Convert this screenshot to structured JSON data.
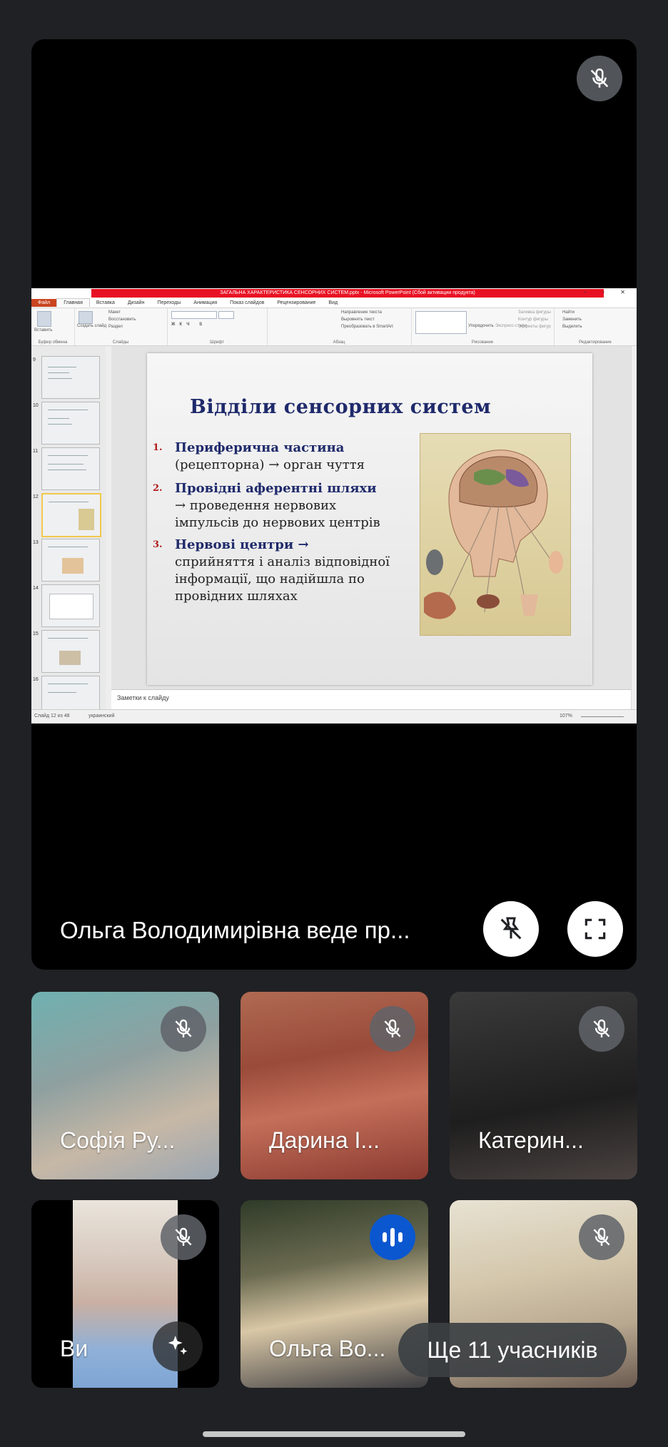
{
  "presenter": {
    "label": "Ольга Володимирівна веде пр...",
    "mic_icon": "mic-off-icon",
    "unpin_icon": "unpin-icon",
    "fullscreen_icon": "fullscreen-icon"
  },
  "powerpoint": {
    "window_title": "ЗАГАЛЬНА ХАРАКТЕРИСТИКА СЕНСОРНИХ СИСТЕМ.pptx - Microsoft PowerPoint (Сбой активации продукта)",
    "tabs": [
      "Файл",
      "Главная",
      "Вставка",
      "Дизайн",
      "Переходы",
      "Анимация",
      "Показ слайдов",
      "Рецензирование",
      "Вид"
    ],
    "active_tab": "Главная",
    "ribbon": {
      "paste": "Вставить",
      "create_slide": "Создать слайд",
      "layout": "Макет",
      "reset": "Восстановить",
      "section": "Раздел",
      "text_direction": "Направление текста",
      "align_text": "Выровнять текст",
      "smartart": "Преобразовать в SmartArt",
      "arrange": "Упорядочить",
      "quick_styles": "Экспресс-стили",
      "fill": "Заливка фигуры",
      "outline": "Контур фигуры",
      "effects": "Эффекты фигур",
      "find": "Найти",
      "replace": "Заменить",
      "select": "Выделить",
      "groups": [
        "Буфер обмена",
        "Слайды",
        "Шрифт",
        "Абзац",
        "Рисование",
        "Редактирование"
      ]
    },
    "thumbnails": [
      "9",
      "10",
      "11",
      "12",
      "13",
      "14",
      "15",
      "16"
    ],
    "selected_thumbnail": "12",
    "notes_placeholder": "Заметки к слайду",
    "status": {
      "slide_info": "Слайд 12 из 48",
      "language": "украинский",
      "zoom": "107%"
    },
    "slide": {
      "title": "Відділи сенсорних систем",
      "items": [
        {
          "num": "1.",
          "head": "Периферична частина",
          "lines": [
            "(рецепторна) → орган чуття"
          ]
        },
        {
          "num": "2.",
          "head": "Провідні аферентні шляхи",
          "lines": [
            "→    проведення  нервових",
            "імпульсів до нервових центрів"
          ]
        },
        {
          "num": "3.",
          "head": "Нервові центри →",
          "lines": [
            "сприйняття і аналіз відповідної",
            "інформації, що надійшла по",
            "провідних шляхах"
          ]
        }
      ]
    }
  },
  "participants": [
    {
      "name": "Софія Ру...",
      "status_icon": "mic-off-icon"
    },
    {
      "name": "Дарина І...",
      "status_icon": "mic-off-icon"
    },
    {
      "name": "Катерин...",
      "status_icon": "mic-off-icon"
    },
    {
      "name": "Ви",
      "status_icon": "mic-off-icon",
      "extra_icon": "sparkle-effects-icon"
    },
    {
      "name": "Ольга Во...",
      "status_icon": "speaking-icon"
    },
    {
      "name": "",
      "status_icon": "mic-off-icon"
    }
  ],
  "more_participants": "Ще 11 учасників"
}
